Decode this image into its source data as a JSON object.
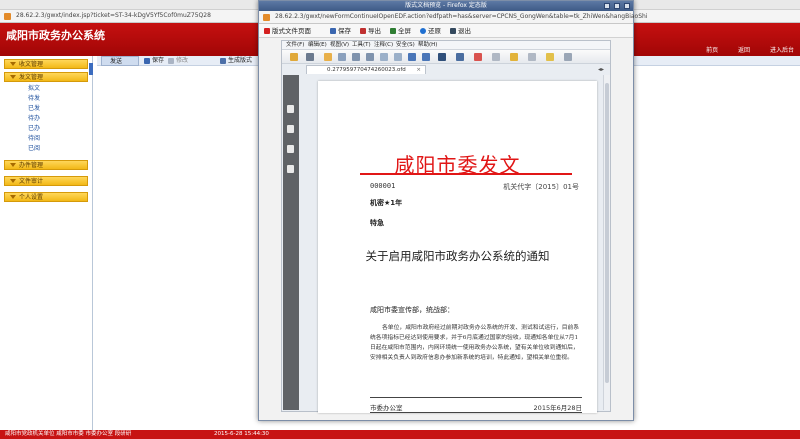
{
  "bg_window": {
    "url": "28.62.2.3/gwxt/index.jsp?ticket=ST-34-kDgV5Yf5Cof0muZ75Q28",
    "app_title": "咸阳市政务办公系统",
    "header_links": [
      "前页",
      "返回",
      "进入后台"
    ],
    "toolbar": {
      "send": "发送",
      "save": "保存",
      "edit": "修改",
      "print": "生成版式"
    },
    "status": {
      "text": "咸阳市党政机关单位 咸阳市市委 市委办公室 段研研",
      "time": "2015-6-28 15:44:30"
    }
  },
  "sidebar": {
    "menus": [
      {
        "label": "收文管理"
      },
      {
        "label": "发文管理"
      },
      {
        "label": "办件管理"
      },
      {
        "label": "文件审计"
      },
      {
        "label": "个人设置"
      }
    ],
    "sub_items": [
      "拟文",
      "待发",
      "已发",
      "待办",
      "已办",
      "待阅",
      "已阅"
    ]
  },
  "popup": {
    "title": "版式文档预览 - Firefox 定态版",
    "url": "28.62.2.3/gwxt/newFormContinueIOpenEDF.action?edfpath=has&server=CPCNS_GongWen&table=tk_ZhiWen&hangBiaoShi",
    "toolbar": [
      "版式文件页面",
      "保存",
      "导出",
      "全屏",
      "还原",
      "退出"
    ],
    "viewer_menu": [
      "文件(F)",
      "编辑(E)",
      "视图(V)",
      "工具(T)",
      "注释(C)",
      "安全(S)",
      "帮助(H)"
    ],
    "tab_label": "0.277959770474260023.ofd"
  },
  "document": {
    "title": "咸阳市委发文",
    "serial": "000001",
    "code": "机关代字〔2015〕01号",
    "secret": "机密★1年",
    "urgency": "特急",
    "heading": "关于启用咸阳市政务办公系统的通知",
    "addressee": "咸阳市委宣传部，统战部：",
    "body": "各单位，咸阳市政府经过前期对政务办公系统的开发、测试和试运行，目前系统各项指标已经达到使用要求，并于6月底通过国家的验收，现通知各单位从7月1日起在咸阳市范围内，内网环境统一使用政务办公系统，望有关单位收到通知后，安排相关负责人到政府信息办参加新系统的培训，特此通知，望相关单位重视。",
    "issuer": "市委办公室",
    "date": "2015年6月28日"
  },
  "colors": {
    "brand_red": "#c61010",
    "menu_yellow": "#f2b817",
    "doc_red": "#e11616"
  }
}
